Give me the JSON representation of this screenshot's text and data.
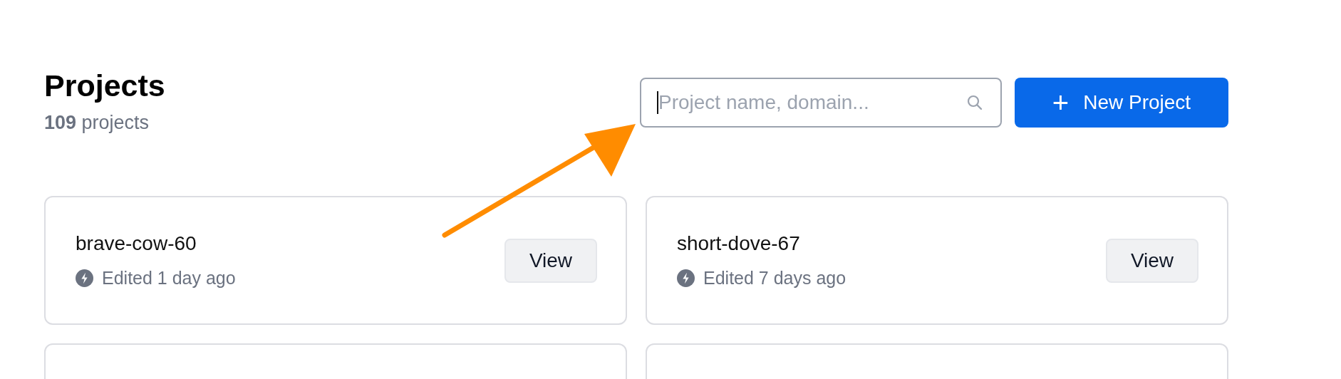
{
  "header": {
    "title": "Projects",
    "count": "109",
    "count_label": "projects"
  },
  "search": {
    "placeholder": "Project name, domain..."
  },
  "new_button": {
    "icon": "+",
    "label": "New Project"
  },
  "projects": [
    {
      "kind": "project",
      "name": "brave-cow-60",
      "edited": "Edited 1 day ago",
      "action": "View"
    },
    {
      "kind": "project",
      "name": "short-dove-67",
      "edited": "Edited 7 days ago",
      "action": "View"
    },
    {
      "kind": "cut"
    },
    {
      "kind": "cut"
    }
  ]
}
